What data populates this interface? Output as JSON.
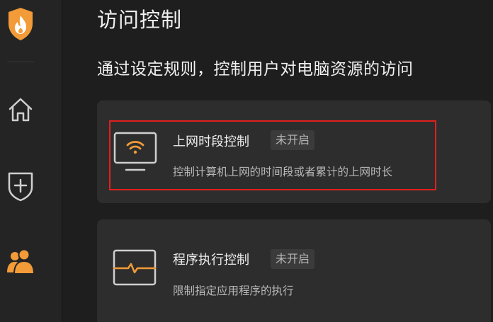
{
  "colors": {
    "accent": "#f29b38",
    "background": "#1e1e1e",
    "sidebar": "#242424",
    "card": "#2d2d2d",
    "highlight": "#e0201e"
  },
  "sidebar": {
    "logo_icon": "shield-flame-icon",
    "items": [
      {
        "name": "home",
        "icon": "home-icon"
      },
      {
        "name": "protection",
        "icon": "shield-plus-icon"
      },
      {
        "name": "access-control",
        "icon": "users-icon",
        "active": true
      }
    ]
  },
  "header": {
    "title": "访问控制",
    "subtitle": "通过设定规则，控制用户对电脑资源的访问"
  },
  "cards": [
    {
      "icon": "monitor-wifi-icon",
      "title": "上网时段控制",
      "status": "未开启",
      "description": "控制计算机上网的时间段或者累计的上网时长",
      "highlighted": true
    },
    {
      "icon": "monitor-pulse-icon",
      "title": "程序执行控制",
      "status": "未开启",
      "description": "限制指定应用程序的执行"
    }
  ]
}
